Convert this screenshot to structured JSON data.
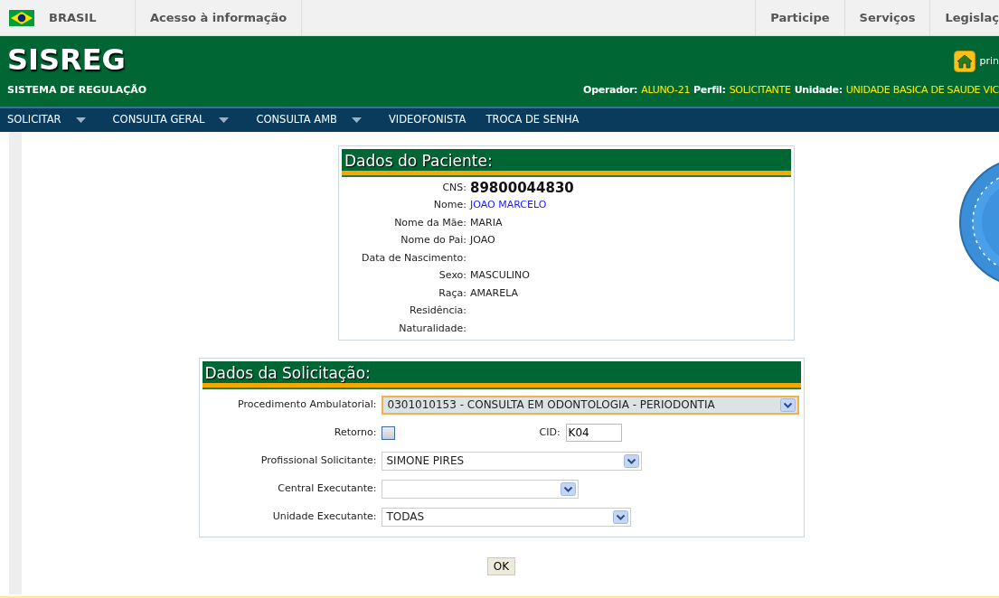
{
  "gov_bar": {
    "brand": "BRASIL",
    "link": "Acesso à informação",
    "right_links": [
      "Participe",
      "Serviços",
      "Legislaç"
    ]
  },
  "header": {
    "title": "SISREG",
    "subtitle": "SISTEMA DE REGULAÇÃO",
    "home_label": "prin",
    "session": [
      {
        "label": "Operador:",
        "value": "ALUNO-21"
      },
      {
        "label": "Perfil:",
        "value": "SOLICITANTE"
      },
      {
        "label": "Unidade:",
        "value": "UNIDADE BASICA DE SAUDE VIC"
      }
    ]
  },
  "nav": [
    {
      "label": "SOLICITAR",
      "has_menu": true
    },
    {
      "label": "CONSULTA GERAL",
      "has_menu": true
    },
    {
      "label": "CONSULTA AMB",
      "has_menu": true
    },
    {
      "label": "VIDEOFONISTA",
      "has_menu": false
    },
    {
      "label": "TROCA DE SENHA",
      "has_menu": false
    }
  ],
  "patient": {
    "title": "Dados do Paciente:",
    "fields": [
      {
        "label": "CNS:",
        "value": "89800044830",
        "kind": "cns"
      },
      {
        "label": "Nome:",
        "value": "JOAO MARCELO",
        "kind": "name"
      },
      {
        "label": "Nome da Mãe:",
        "value": "MARIA",
        "kind": "plain"
      },
      {
        "label": "Nome do Pai:",
        "value": "JOAO",
        "kind": "plain"
      },
      {
        "label": "Data de Nascimento:"
      },
      {
        "label": "Sexo:",
        "value": "MASCULINO",
        "kind": "plain"
      },
      {
        "label": "Raça:",
        "value": "AMARELA",
        "kind": "plain"
      },
      {
        "label": "Residência:"
      },
      {
        "label": "Naturalidade:"
      }
    ]
  },
  "request": {
    "title": "Dados da Solicitação:",
    "procedure": {
      "label": "Procedimento Ambulatorial:",
      "value": "0301010153 - CONSULTA EM ODONTOLOGIA - PERIODONTIA",
      "focused": true
    },
    "retorno": {
      "label": "Retorno:",
      "checked": false
    },
    "cid": {
      "label": "CID:",
      "value": "K04"
    },
    "selects": [
      {
        "label": "Profissional Solicitante:",
        "value": "SIMONE PIRES"
      },
      {
        "label": "Central Executante:"
      },
      {
        "label": "Unidade Executante:",
        "value": "TODAS"
      }
    ]
  },
  "ok_button": "OK"
}
